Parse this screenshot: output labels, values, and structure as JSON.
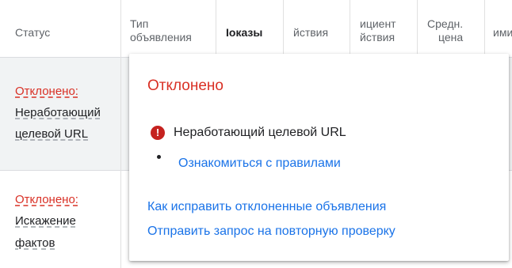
{
  "columns": [
    {
      "label": "Статус"
    },
    {
      "label": "Тип\nобъявления"
    },
    {
      "label": "Iоказы"
    },
    {
      "label": "йствия"
    },
    {
      "label": "ициент\nйствия"
    },
    {
      "label": "Средн.\nцена"
    },
    {
      "label": "ими"
    }
  ],
  "rows": [
    {
      "status": "Отклонено:",
      "reason_lines": [
        "Неработающий",
        "целевой URL"
      ]
    },
    {
      "status": "Отклонено:",
      "reason_lines": [
        "Искажение",
        "фактов"
      ]
    }
  ],
  "popup": {
    "title": "Отклонено",
    "reason": "Неработающий целевой URL",
    "error_icon_glyph": "!",
    "policy_link": "Ознакомиться с правилами",
    "fix_link": "Как исправить отклоненные объявления",
    "appeal_link": "Отправить запрос на повторную проверку"
  },
  "colors": {
    "rejected": "#d93025",
    "link": "#1a73e8",
    "error_icon": "#c5221f",
    "selected_row": "#f1f3f4"
  }
}
